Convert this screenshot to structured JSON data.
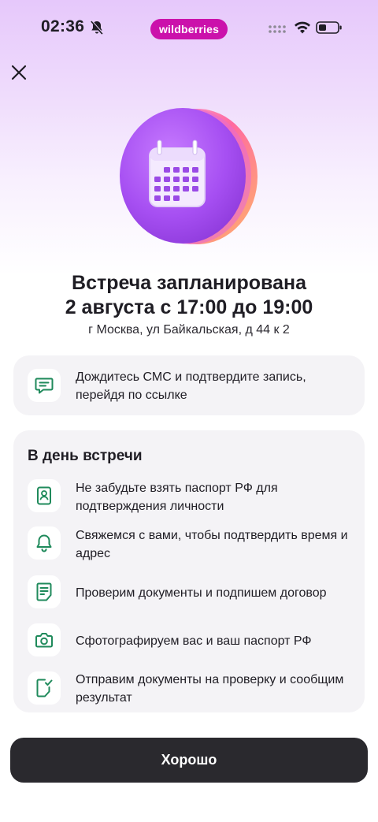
{
  "status_bar": {
    "time": "02:36",
    "brand": "wildberries",
    "icons": [
      "bell-off-icon",
      "signal-icon",
      "wifi-icon",
      "battery-icon"
    ]
  },
  "header": {
    "close_icon": "close-icon"
  },
  "hero": {
    "icon": "calendar-icon"
  },
  "title_line1": "Встреча запланирована",
  "title_line2": "2 августа с 17:00 до 19:00",
  "address": "г Москва, ул Байкальская, д 44 к 2",
  "sms_card": {
    "icon": "message-icon",
    "text": "Дождитесь СМС и подтвердите запись, перейдя по ссылке"
  },
  "day_card": {
    "title": "В день встречи",
    "items": [
      {
        "icon": "passport-icon",
        "text": "Не забудьте взять паспорт РФ для подтверждения личности"
      },
      {
        "icon": "bell-icon",
        "text": "Свяжемся с вами, чтобы подтвердить время и адрес"
      },
      {
        "icon": "document-icon",
        "text": "Проверим документы и подпишем договор"
      },
      {
        "icon": "camera-icon",
        "text": "Сфотографируем вас и ваш паспорт РФ"
      },
      {
        "icon": "document-check-icon",
        "text": "Отправим документы на проверку и сообщим результат"
      }
    ]
  },
  "ok_button_label": "Хорошо",
  "colors": {
    "accent_green": "#1f8a5b",
    "brand_pink": "#cb11ab",
    "hero_purple": "#a44ef0",
    "button_dark": "#2a292e"
  }
}
